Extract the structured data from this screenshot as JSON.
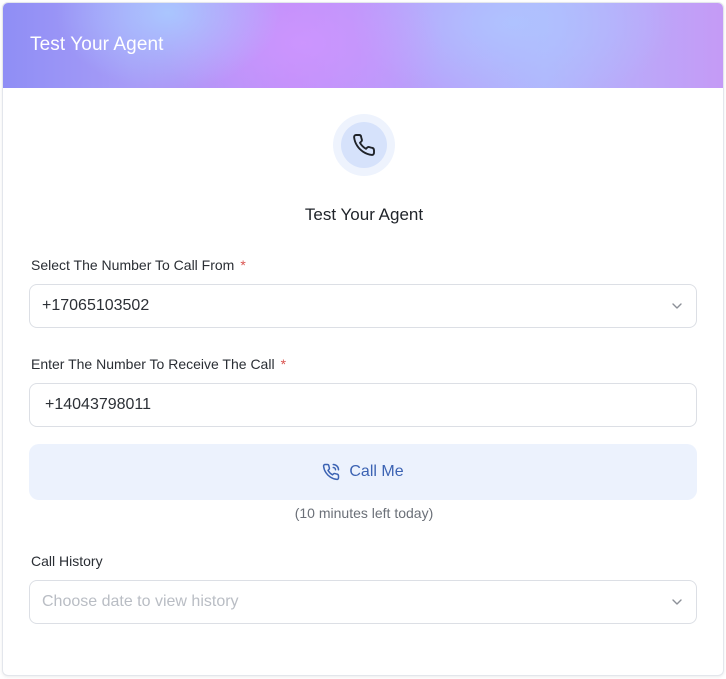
{
  "header": {
    "title": "Test Your Agent"
  },
  "icons": {
    "badge": "phone-icon",
    "call_button": "phone-call-icon",
    "dropdown": "chevron-down-icon"
  },
  "main": {
    "title": "Test Your Agent",
    "from_field": {
      "label": "Select The Number To Call From",
      "required_mark": "*",
      "value": "+17065103502"
    },
    "to_field": {
      "label": "Enter The Number To Receive The Call",
      "required_mark": "*",
      "value": "+14043798011"
    },
    "call_button": {
      "label": "Call Me"
    },
    "minutes_note": "(10 minutes left today)",
    "history": {
      "label": "Call History",
      "placeholder": "Choose date to view history"
    }
  },
  "colors": {
    "accent": "#3c63b3",
    "button_bg": "#ecf2fd",
    "required": "#d9534f"
  }
}
